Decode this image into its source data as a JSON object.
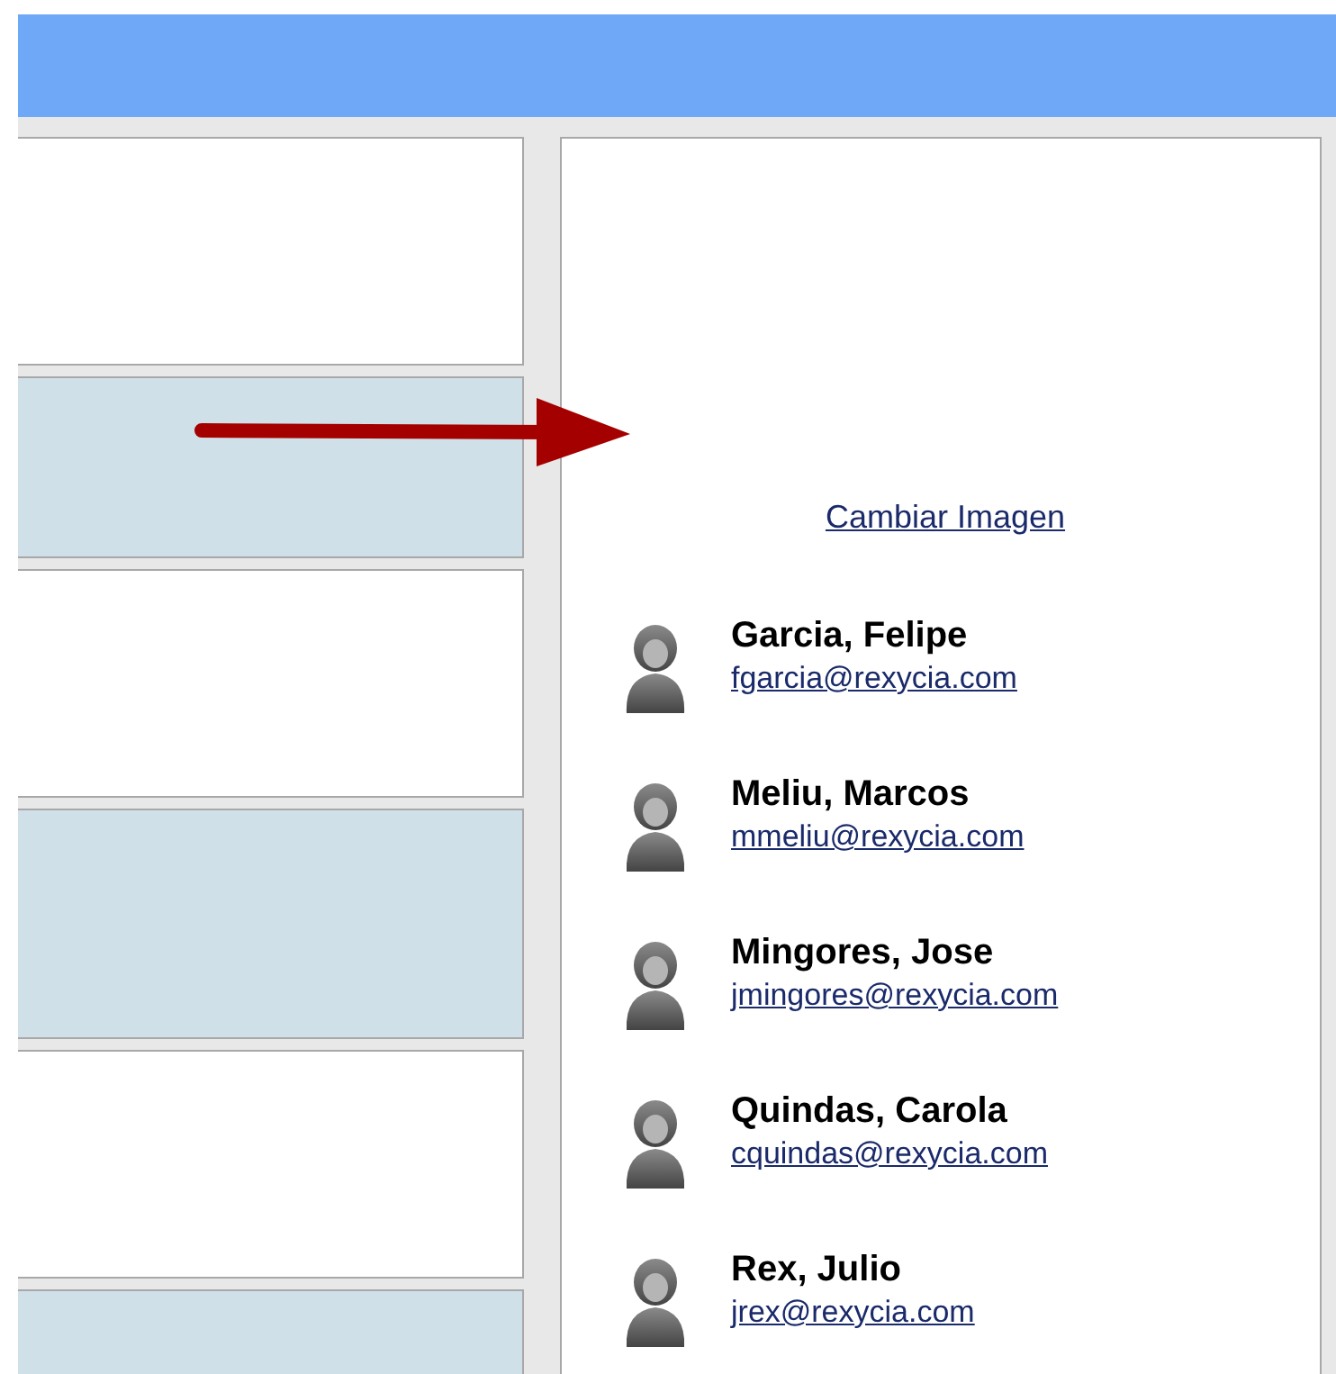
{
  "rows": [
    {
      "shaded": false
    },
    {
      "shaded": true
    },
    {
      "shaded": false
    },
    {
      "shaded": true
    },
    {
      "shaded": false
    },
    {
      "shaded": true
    }
  ],
  "panel": {
    "link": "Cambiar Imagen",
    "contacts": [
      {
        "name": "Garcia, Felipe",
        "email": "fgarcia@rexycia.com"
      },
      {
        "name": "Meliu, Marcos",
        "email": "mmeliu@rexycia.com"
      },
      {
        "name": "Mingores, Jose",
        "email": "jmingores@rexycia.com"
      },
      {
        "name": "Quindas, Carola",
        "email": "cquindas@rexycia.com"
      },
      {
        "name": "Rex, Julio",
        "email": "jrex@rexycia.com"
      }
    ]
  }
}
